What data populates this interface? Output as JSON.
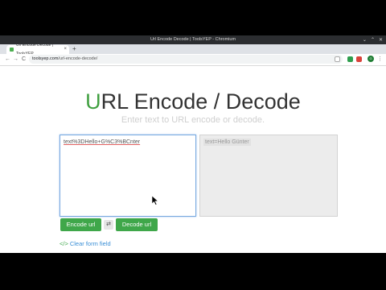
{
  "window": {
    "title": "Url Encode Decode | ToolsYEP - Chromium",
    "buttons": [
      "⌄",
      "⌃",
      "✕"
    ]
  },
  "tab": {
    "title": "Url Encode Decode | ToolsYEP",
    "close": "×",
    "new_tab": "+"
  },
  "toolbar": {
    "back": "←",
    "forward": "→",
    "reload": "C",
    "url_host": "toolsyep.com",
    "url_path": "/url-encode-decode/",
    "avatar_text": "G"
  },
  "page": {
    "title_first_letter": "U",
    "title_rest": "RL Encode / Decode",
    "subtitle": "Enter text to URL encode or decode.",
    "input_value": "text%3DHello+G%C3%BCnter",
    "output_value": "text=Hello Günter",
    "encode_label": "Encode url",
    "swap_label": "⇄",
    "decode_label": "Decode url",
    "clear_icon": "</>",
    "clear_label": "Clear form field"
  },
  "colors": {
    "accent": "#3fa74a",
    "link": "#3a8fd6"
  }
}
